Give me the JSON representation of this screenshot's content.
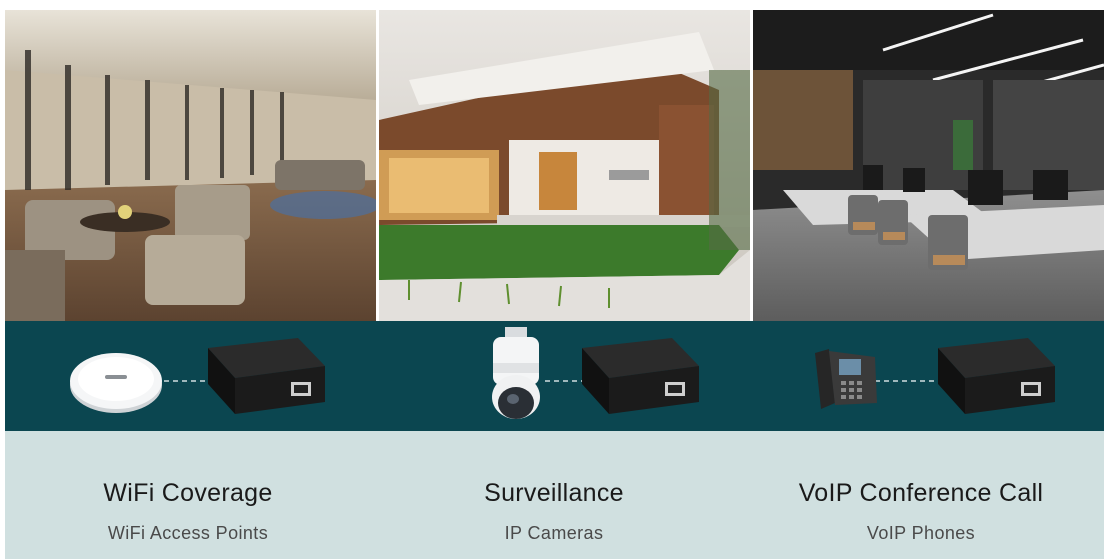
{
  "scenes": [
    {
      "title": "WiFi Coverage",
      "subtitle": "WiFi Access Points",
      "device_icon": "access-point-icon"
    },
    {
      "title": "Surveillance",
      "subtitle": "IP Cameras",
      "device_icon": "dome-camera-icon"
    },
    {
      "title": "VoIP Conference Call",
      "subtitle": "VoIP Phones",
      "device_icon": "desk-phone-icon"
    }
  ],
  "injector_icon": "poe-injector-icon",
  "colors": {
    "band": "#0b4650",
    "caption_bg": "#d0e0e0",
    "title_text": "#1a1a1a",
    "subtitle_text": "#4a4a4a"
  }
}
